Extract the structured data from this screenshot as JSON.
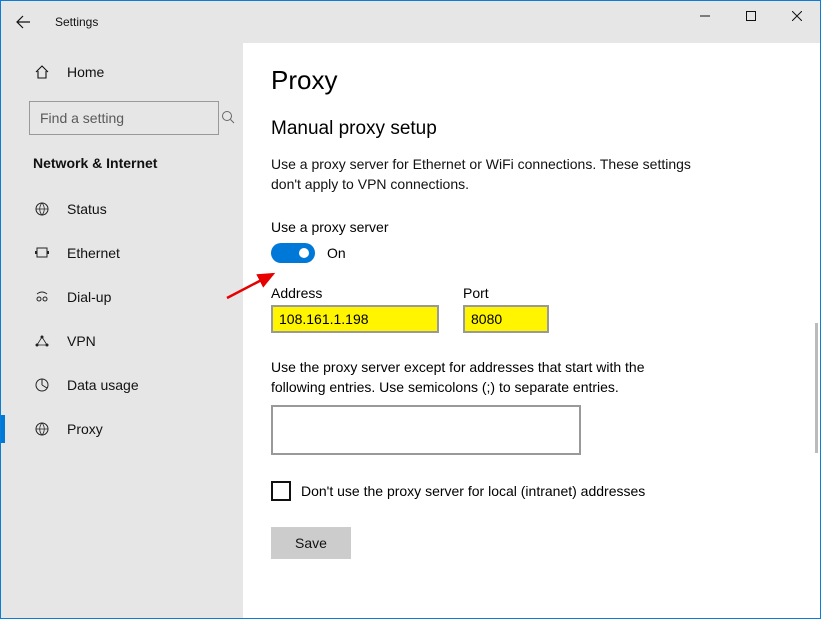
{
  "titlebar": {
    "title": "Settings"
  },
  "sidebar": {
    "home_label": "Home",
    "search_placeholder": "Find a setting",
    "category": "Network & Internet",
    "items": [
      {
        "label": "Status"
      },
      {
        "label": "Ethernet"
      },
      {
        "label": "Dial-up"
      },
      {
        "label": "VPN"
      },
      {
        "label": "Data usage"
      },
      {
        "label": "Proxy"
      }
    ]
  },
  "page": {
    "title": "Proxy",
    "section_title": "Manual proxy setup",
    "description": "Use a proxy server for Ethernet or WiFi connections. These settings don't apply to VPN connections.",
    "toggle_title": "Use a proxy server",
    "toggle_state_label": "On",
    "address_label": "Address",
    "address_value": "108.161.1.198",
    "port_label": "Port",
    "port_value": "8080",
    "exclusion_desc": "Use the proxy server except for addresses that start with the following entries. Use semicolons (;) to separate entries.",
    "exclusion_value": "",
    "intranet_checkbox_label": "Don't use the proxy server for local (intranet) addresses",
    "save_label": "Save"
  },
  "colors": {
    "accent": "#0078d7",
    "highlight": "#fff500"
  }
}
